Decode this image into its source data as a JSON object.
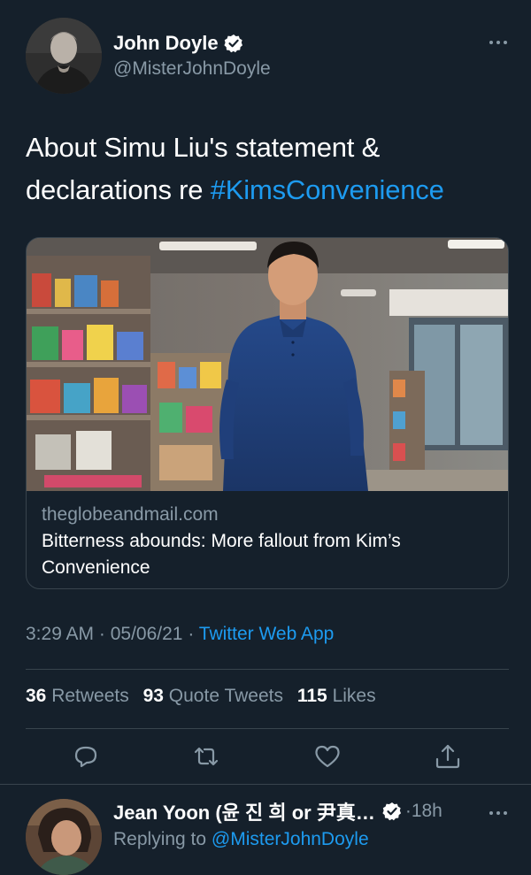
{
  "tweet": {
    "author_name": "John Doyle",
    "author_handle": "@MisterJohnDoyle",
    "verified": true,
    "text_prefix": "About Simu Liu's statement & declarations re ",
    "hashtag": "#KimsConvenience",
    "card": {
      "domain": "theglobeandmail.com",
      "title": "Bitterness abounds: More fallout from Kim’s Convenience"
    },
    "time": "3:29 AM",
    "date": "05/06/21",
    "separator": " · ",
    "app": "Twitter Web App",
    "stats": {
      "retweets_count": "36",
      "retweets_label": "Retweets",
      "quotes_count": "93",
      "quotes_label": "Quote Tweets",
      "likes_count": "115",
      "likes_label": "Likes"
    },
    "actions": [
      "reply-icon",
      "retweet-icon",
      "like-icon",
      "share-icon"
    ]
  },
  "reply": {
    "author_name": "Jean Yoon (윤 진 희 or 尹真…",
    "verified": true,
    "time": "·18h",
    "replying_prefix": "Replying to ",
    "replying_handle": "@MisterJohnDoyle"
  },
  "colors": {
    "background": "#15202b",
    "accent": "#1d9bf0",
    "secondary_text": "#8899a6",
    "divider": "#38444d"
  }
}
